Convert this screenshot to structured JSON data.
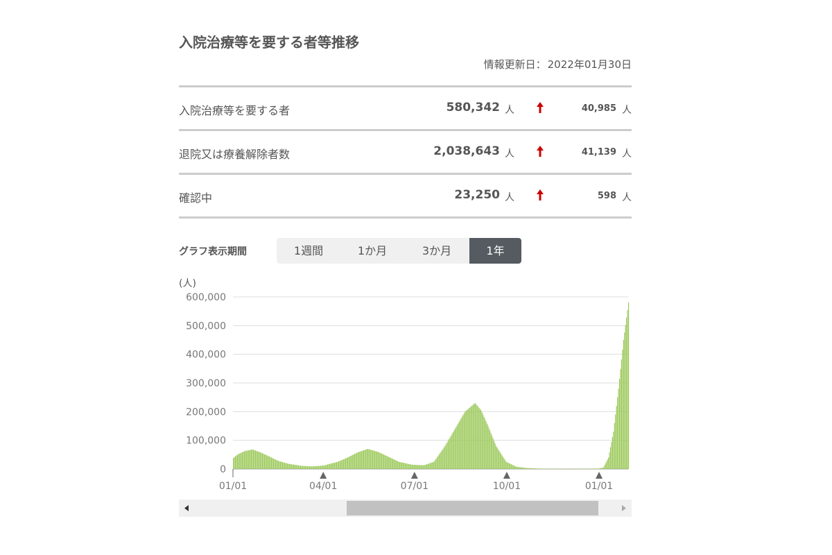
{
  "header": {
    "title": "入院治療等を要する者等推移",
    "updated_label": "情報更新日：",
    "updated_date": "2022年01月30日"
  },
  "stats": [
    {
      "name": "入院治療等を要する者",
      "value": "580,342",
      "unit": "人",
      "diff": "40,985",
      "diff_unit": "人",
      "trend": "up"
    },
    {
      "name": "退院又は療養解除者数",
      "value": "2,038,643",
      "unit": "人",
      "diff": "41,139",
      "diff_unit": "人",
      "trend": "up"
    },
    {
      "name": "確認中",
      "value": "23,250",
      "unit": "人",
      "diff": "598",
      "diff_unit": "人",
      "trend": "up"
    }
  ],
  "period": {
    "label": "グラフ表示期間",
    "options": [
      "1週間",
      "1か月",
      "3か月",
      "1年"
    ],
    "selected": "1年"
  },
  "colors": {
    "bar": "#9bc95a",
    "arrow": "#cc0000",
    "active_tab": "#555b60"
  },
  "icons": {
    "trend": "up-arrow-icon",
    "scroll_left": "triangle-left-icon",
    "scroll_right": "triangle-right-icon",
    "tick_marker": "triangle-up-icon"
  },
  "chart_data": {
    "type": "bar",
    "ylabel": "(人)",
    "ylim": [
      0,
      600000
    ],
    "yticks": [
      "600,000",
      "500,000",
      "400,000",
      "300,000",
      "200,000",
      "100,000",
      "0"
    ],
    "x_tick_labels": [
      "01/01",
      "04/01",
      "07/01",
      "10/01",
      "01/01"
    ],
    "x_tick_dates": [
      "2021-01-01",
      "2021-04-01",
      "2021-07-01",
      "2021-10-01",
      "2022-01-01"
    ],
    "x_range": [
      "2021-01-01",
      "2022-01-30"
    ],
    "grid": true,
    "keypoints": [
      [
        "2021-01-01",
        38000
      ],
      [
        "2021-01-05",
        50000
      ],
      [
        "2021-01-12",
        62000
      ],
      [
        "2021-01-20",
        68000
      ],
      [
        "2021-01-28",
        58000
      ],
      [
        "2021-02-05",
        45000
      ],
      [
        "2021-02-15",
        28000
      ],
      [
        "2021-02-25",
        18000
      ],
      [
        "2021-03-10",
        11000
      ],
      [
        "2021-03-20",
        9000
      ],
      [
        "2021-04-01",
        12000
      ],
      [
        "2021-04-15",
        25000
      ],
      [
        "2021-04-25",
        40000
      ],
      [
        "2021-05-05",
        58000
      ],
      [
        "2021-05-15",
        70000
      ],
      [
        "2021-05-25",
        60000
      ],
      [
        "2021-06-05",
        42000
      ],
      [
        "2021-06-15",
        25000
      ],
      [
        "2021-06-28",
        15000
      ],
      [
        "2021-07-10",
        13000
      ],
      [
        "2021-07-20",
        25000
      ],
      [
        "2021-07-31",
        80000
      ],
      [
        "2021-08-10",
        140000
      ],
      [
        "2021-08-20",
        200000
      ],
      [
        "2021-08-30",
        230000
      ],
      [
        "2021-09-05",
        205000
      ],
      [
        "2021-09-12",
        150000
      ],
      [
        "2021-09-20",
        80000
      ],
      [
        "2021-09-30",
        25000
      ],
      [
        "2021-10-10",
        8000
      ],
      [
        "2021-10-20",
        3500
      ],
      [
        "2021-11-01",
        1500
      ],
      [
        "2021-12-01",
        800
      ],
      [
        "2021-12-31",
        1500
      ],
      [
        "2022-01-05",
        5000
      ],
      [
        "2022-01-10",
        40000
      ],
      [
        "2022-01-15",
        130000
      ],
      [
        "2022-01-20",
        280000
      ],
      [
        "2022-01-25",
        450000
      ],
      [
        "2022-01-30",
        580342
      ]
    ]
  },
  "scrollbar": {
    "position": 0.36,
    "size": 0.6
  }
}
